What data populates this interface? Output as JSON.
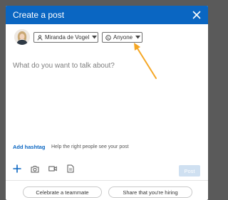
{
  "dialog": {
    "title": "Create a post"
  },
  "author": {
    "name": "Miranda de Vogel"
  },
  "audience": {
    "label": "Anyone"
  },
  "composer": {
    "placeholder": "What do you want to talk about?"
  },
  "hashtag": {
    "button_label": "Add hashtag",
    "hint": "Help the right people see your post"
  },
  "toolbar": {
    "icons": [
      "plus-icon",
      "camera-icon",
      "video-icon",
      "document-icon"
    ],
    "post_label": "Post"
  },
  "suggestions": {
    "items": [
      "Celebrate a teammate",
      "Share that you're hiring"
    ]
  },
  "colors": {
    "brand": "#0a66c2",
    "annotation_arrow": "#f5a623",
    "post_disabled": "#cfe0f1"
  }
}
